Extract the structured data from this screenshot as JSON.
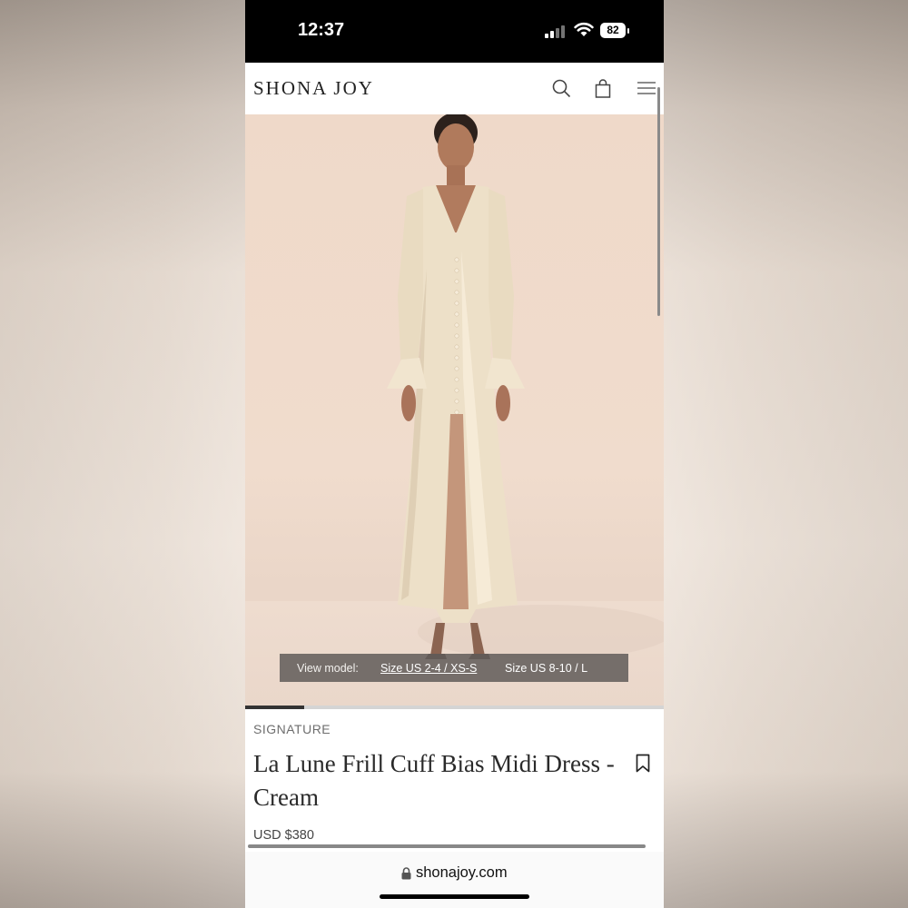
{
  "status_bar": {
    "time": "12:37",
    "battery": "82"
  },
  "header": {
    "logo": "SHONA JOY"
  },
  "hero": {
    "view_model_label": "View model:",
    "sizes": [
      "Size US 2-4 / XS-S",
      "Size US 8-10 / L"
    ],
    "selected_size_index": 0,
    "gallery_progress": 0.14
  },
  "product": {
    "collection": "SIGNATURE",
    "title": "La Lune Frill Cuff Bias Midi Dress - Cream",
    "price": "USD $380"
  },
  "browser": {
    "url": "shonajoy.com"
  },
  "icons": {
    "search": "search-icon",
    "bag": "shopping-bag-icon",
    "menu": "hamburger-menu-icon",
    "bookmark": "bookmark-icon",
    "lock": "lock-icon",
    "wifi": "wifi-icon",
    "signal": "cellular-signal-icon"
  }
}
